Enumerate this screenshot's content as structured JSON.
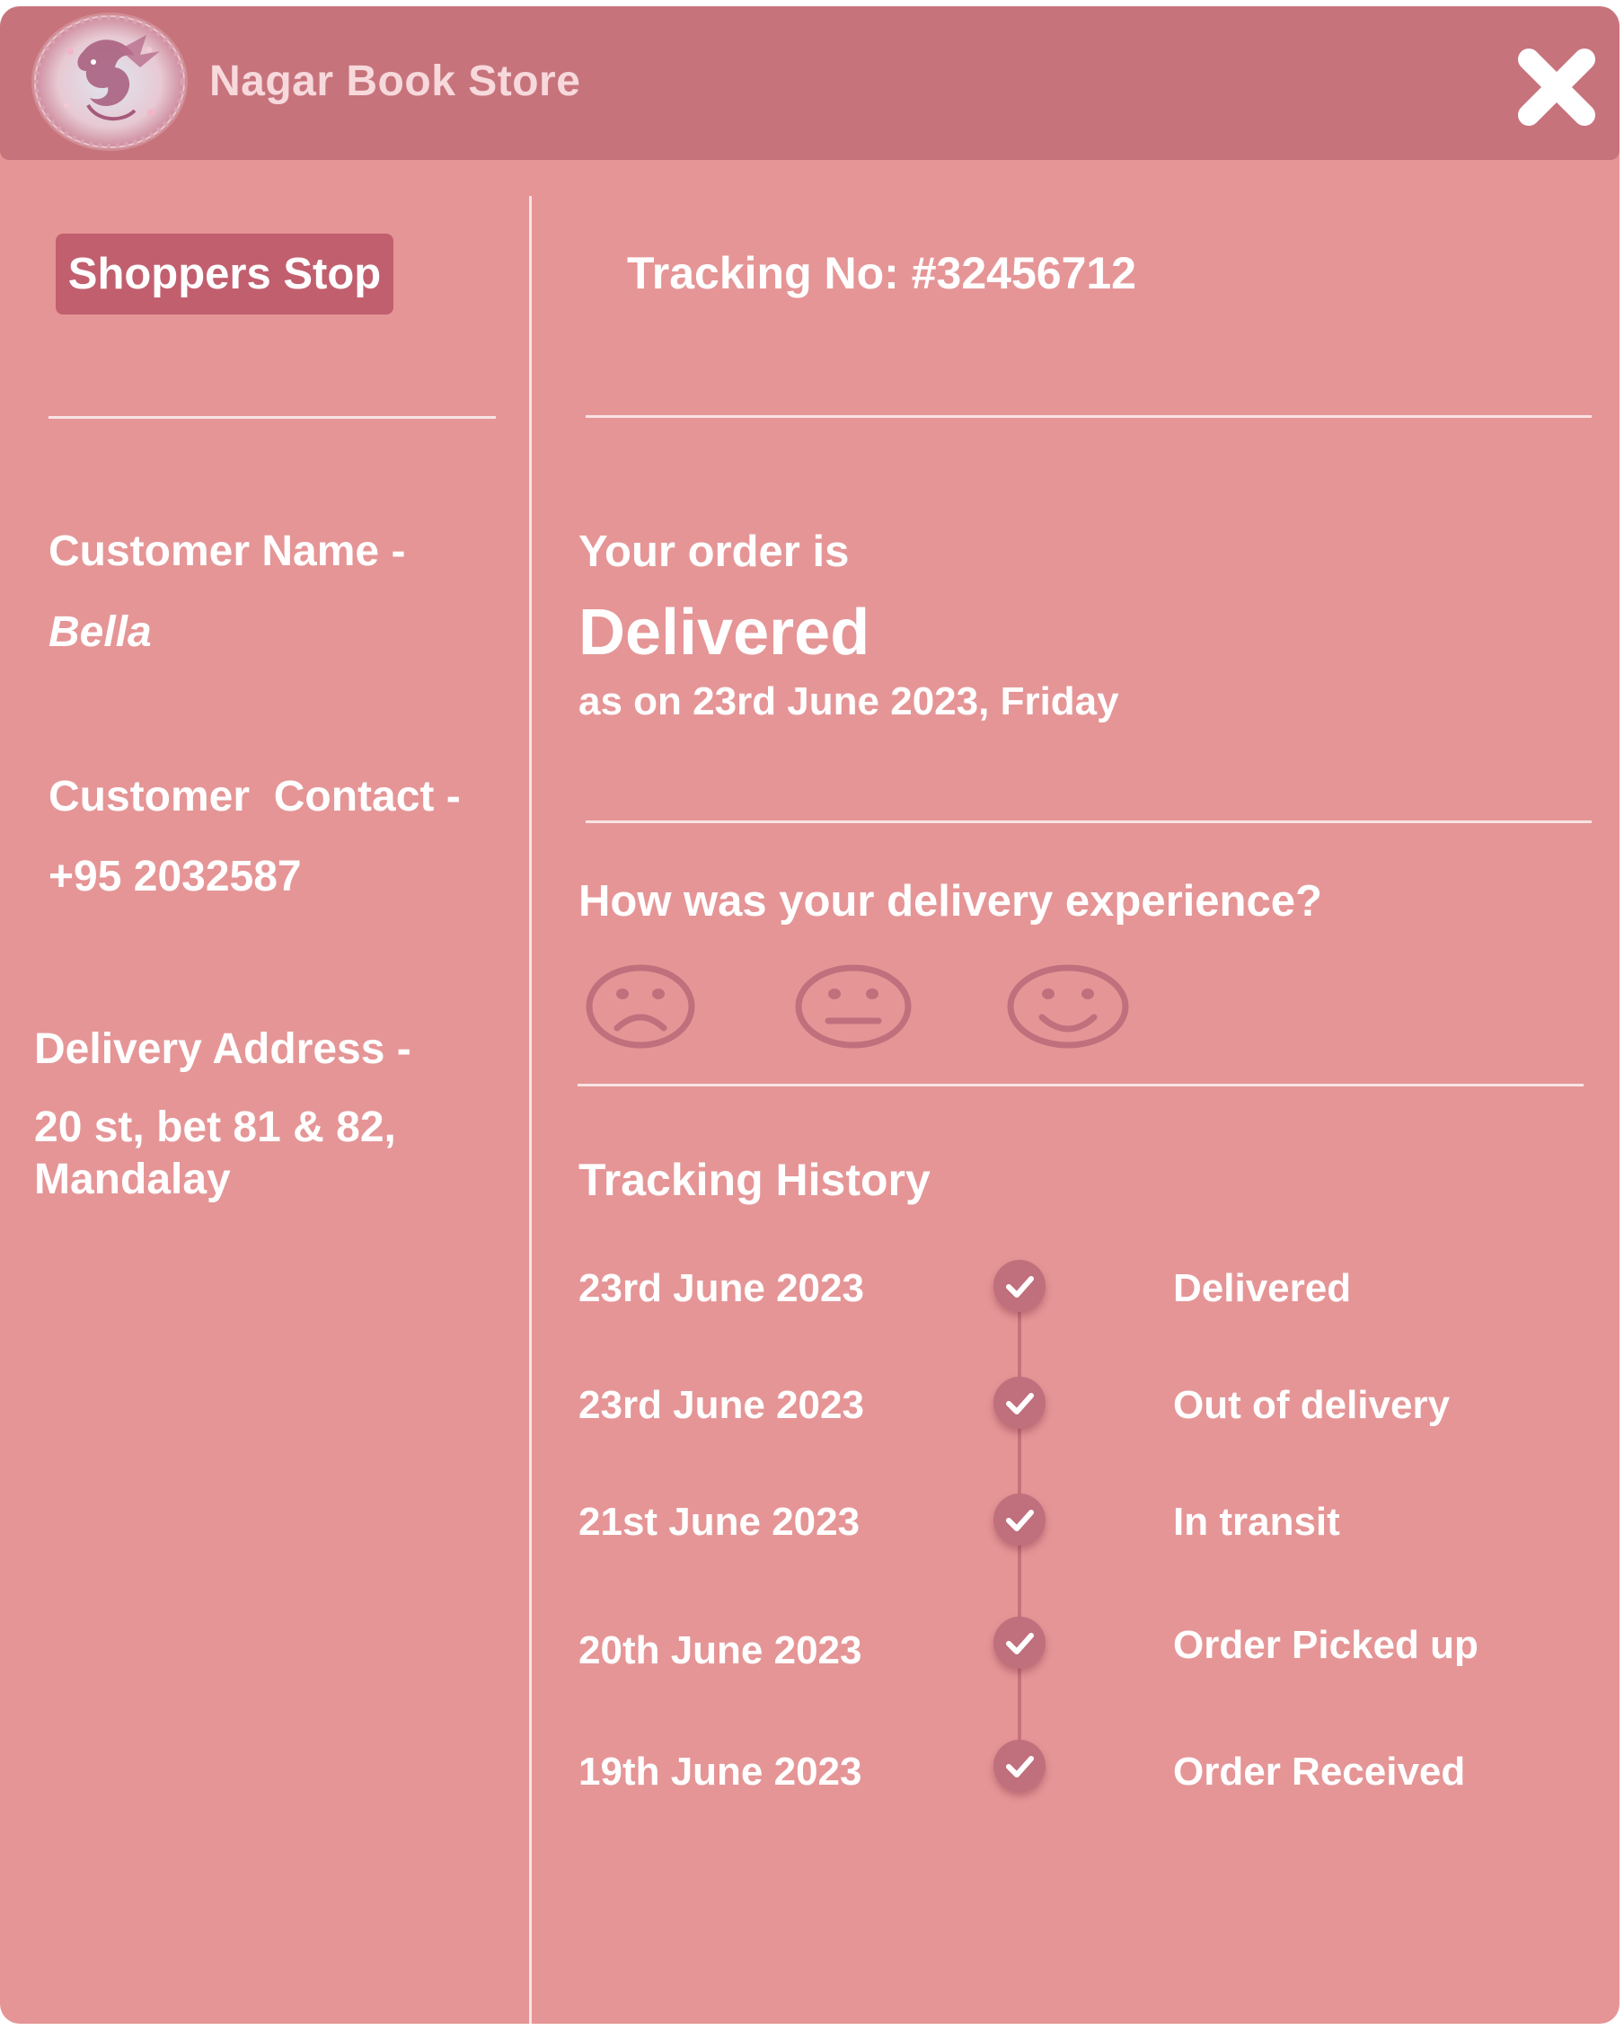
{
  "header": {
    "title": "Nagar Book Store",
    "logo_icon": "dragon-logo-icon",
    "close_icon": "close-icon"
  },
  "sidebar": {
    "store_label": "Shoppers Stop",
    "customer_name_label": "Customer Name -",
    "customer_name_value": "Bella",
    "customer_contact_label": "Customer  Contact -",
    "customer_contact_value": "+95 2032587",
    "delivery_address_label": "Delivery Address -",
    "delivery_address_line1": "20 st, bet 81 & 82,",
    "delivery_address_line2": "Mandalay"
  },
  "main": {
    "tracking_no": "Tracking No: #32456712",
    "order_intro": "Your order is",
    "order_status": "Delivered",
    "order_date": "as on 23rd June 2023, Friday",
    "feedback_question": "How was your delivery experience?",
    "feedback_options": [
      "sad-face-icon",
      "neutral-face-icon",
      "happy-face-icon"
    ],
    "tracking_history_title": "Tracking History",
    "history": [
      {
        "date": "23rd June 2023",
        "status": "Delivered"
      },
      {
        "date": "23rd June 2023",
        "status": "Out of delivery"
      },
      {
        "date": "21st June 2023",
        "status": "In transit"
      },
      {
        "date": "20th June 2023",
        "status": "Order Picked up"
      },
      {
        "date": "19th June 2023",
        "status": "Order Received"
      }
    ]
  },
  "colors": {
    "panel_background": "#e59596",
    "header_background": "#c7737c",
    "badge_background": "#c15f6e",
    "icon_color": "#c06f7d",
    "text": "#ffffff"
  }
}
